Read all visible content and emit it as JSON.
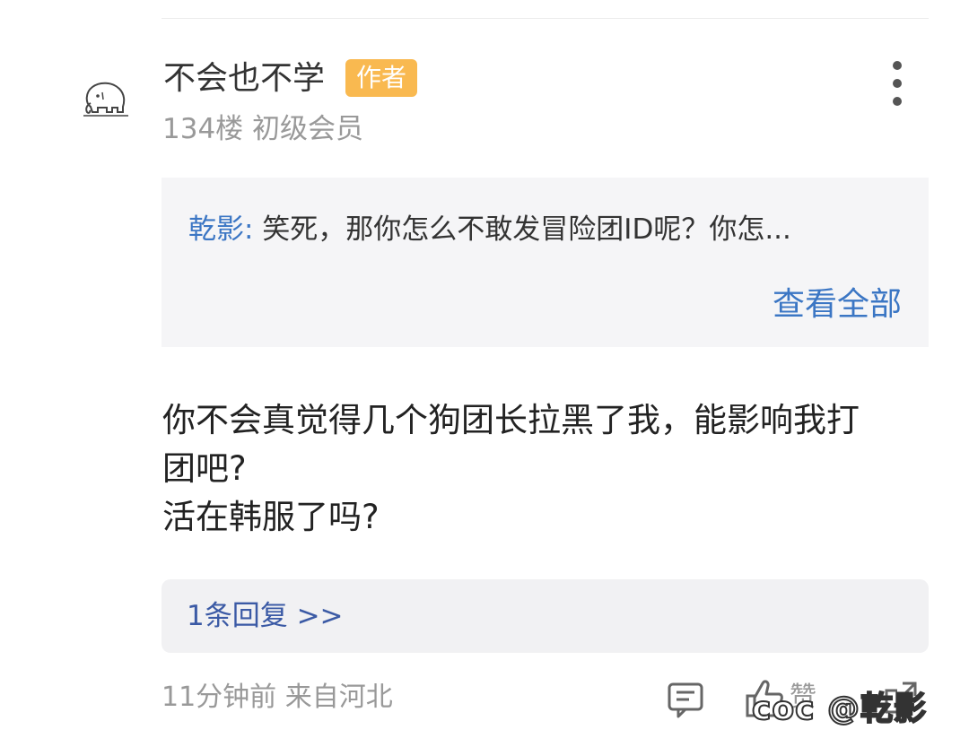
{
  "post": {
    "username": "不会也不学",
    "author_badge": "作者",
    "floor_info": "134楼 初级会员"
  },
  "quote": {
    "author": "乾影:",
    "text": " 笑死，那你怎么不敢发冒险团ID呢？你怎...",
    "view_all": "查看全部"
  },
  "comment": {
    "lines": [
      "你不会真觉得几个狗团长拉黑了我，能影响我打",
      "团吧?",
      "活在韩服了吗?"
    ]
  },
  "replies": {
    "label": "1条回复 >>"
  },
  "footer": {
    "meta": "11分钟前 来自河北",
    "like_label": "赞"
  },
  "watermark": {
    "text": "coc @乾影"
  },
  "icons": {
    "avatar": "elephant-sketch-icon",
    "more": "more-vertical-icon",
    "comment": "comment-icon",
    "like": "thumbs-up-icon",
    "share": "share-icon"
  },
  "colors": {
    "badge": "#f9b950",
    "link": "#3b76c4",
    "reply_link": "#3b5aa5",
    "muted": "#999999",
    "quote_bg": "#f5f5f7"
  }
}
